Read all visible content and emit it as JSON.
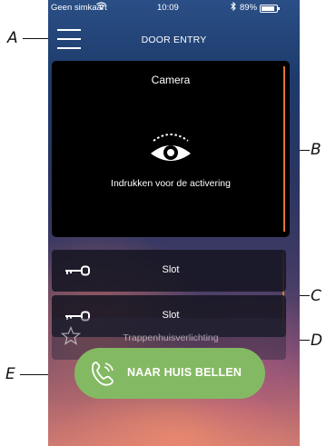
{
  "callouts": {
    "a": "A",
    "b": "B",
    "c": "C",
    "d": "D",
    "e": "E"
  },
  "status_bar": {
    "carrier": "Geen simkaart",
    "wifi_icon": "wifi-icon",
    "time": "10:09",
    "bluetooth_icon": "bluetooth-icon",
    "battery_percent": "89%"
  },
  "header": {
    "menu_icon": "hamburger-menu-icon",
    "title": "DOOR ENTRY"
  },
  "camera": {
    "label": "Camera",
    "icon": "eye-icon",
    "activate_text": "Indrukken voor de activering"
  },
  "locks": [
    {
      "label": "Slot",
      "icon": "key-icon"
    },
    {
      "label": "Slot",
      "icon": "key-icon"
    }
  ],
  "lights": {
    "label": "Trappenhuisverlichting",
    "icon": "star-icon"
  },
  "call_button": {
    "label": "NAAR HUIS BELLEN",
    "icon": "phone-icon"
  },
  "colors": {
    "accent": "#e0752e",
    "call_button": "#84b963",
    "card_background": "#000000"
  }
}
